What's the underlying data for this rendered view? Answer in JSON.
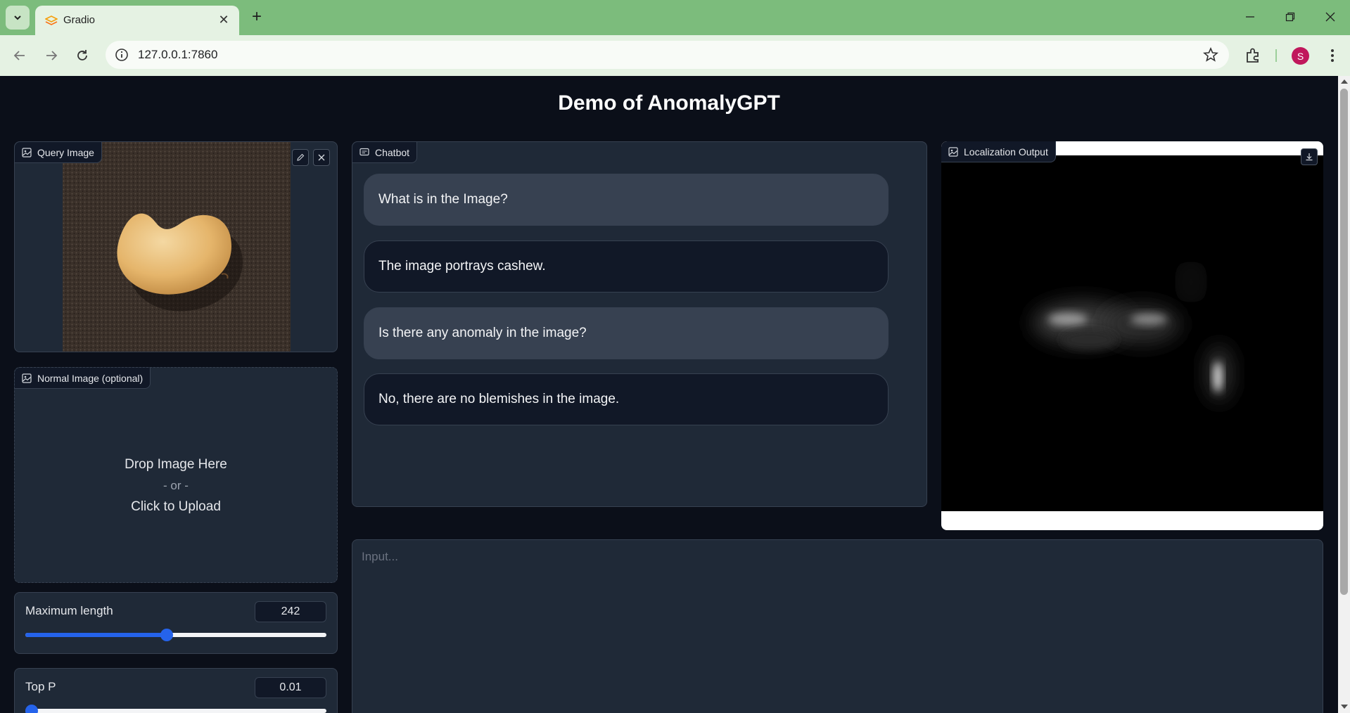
{
  "browser": {
    "tab_title": "Gradio",
    "url": "127.0.0.1:7860",
    "profile_initial": "S",
    "accent_color": "#7cbc7c"
  },
  "app": {
    "title": "Demo of AnomalyGPT",
    "query_image": {
      "label": "Query Image"
    },
    "normal_image": {
      "label": "Normal Image (optional)",
      "drop_text": "Drop Image Here",
      "or_text": "- or -",
      "click_text": "Click to Upload"
    },
    "sliders": [
      {
        "label": "Maximum length",
        "value": "242",
        "fraction": 0.47
      },
      {
        "label": "Top P",
        "value": "0.01",
        "fraction": 0.02
      }
    ],
    "chatbot": {
      "label": "Chatbot",
      "messages": [
        {
          "role": "user",
          "text": "What is in the Image?"
        },
        {
          "role": "bot",
          "text": "The image portrays cashew."
        },
        {
          "role": "user",
          "text": "Is there any anomaly in the image?"
        },
        {
          "role": "bot",
          "text": "No, there are no blemishes in the image."
        }
      ]
    },
    "localization": {
      "label": "Localization Output"
    },
    "input": {
      "placeholder": "Input..."
    }
  }
}
